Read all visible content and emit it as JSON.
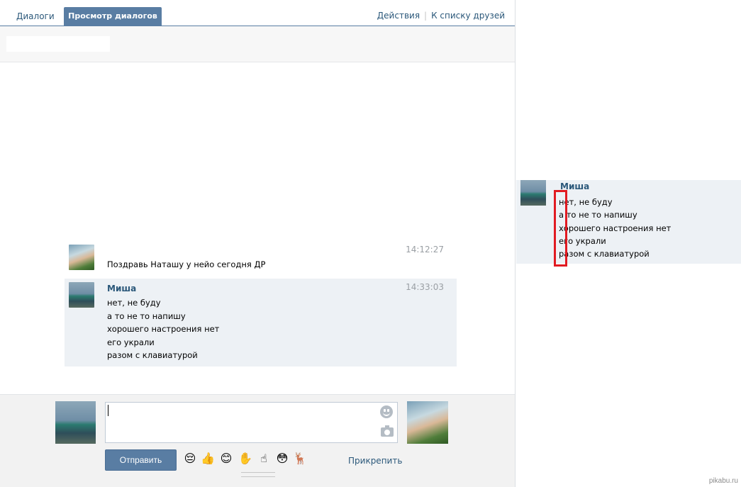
{
  "tabs": [
    {
      "label": "Диалоги",
      "active": false
    },
    {
      "label": "Просмотр диалогов",
      "active": true
    }
  ],
  "top_links": {
    "actions": "Действия",
    "separator": "|",
    "friends": "К списку друзей"
  },
  "messages": [
    {
      "avatar": "girl-photo",
      "author": "",
      "time": "14:12:27",
      "lines": [
        "Поздравь Наташу у нейо сегодня ДР"
      ]
    },
    {
      "avatar": "boy-photo",
      "author": "Миша",
      "time": "14:33:03",
      "lines": [
        "нет, не буду",
        "а то не то напишу",
        "хорошего настроения нет",
        "его украли",
        "разом с клавиатурой"
      ]
    }
  ],
  "composer": {
    "value": "",
    "send_label": "Отправить",
    "attach_label": "Прикрепить",
    "emojis": [
      "😔",
      "👍",
      "😊",
      "✋",
      "☝",
      "😳",
      "🦌"
    ]
  },
  "zoom": {
    "author": "Миша",
    "lines": [
      "нет, не буду",
      "а то не то напишу",
      "хорошего настроения нет",
      "его украли",
      "разом с клавиатурой"
    ]
  },
  "colors": {
    "accent": "#597da3",
    "link": "#2b587a",
    "highlight": "#e11b22",
    "message_bg": "#edf1f5"
  },
  "watermark": "pikabu.ru"
}
